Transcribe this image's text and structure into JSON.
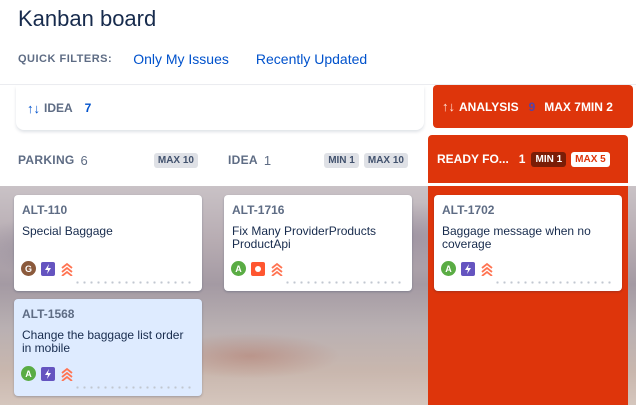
{
  "board": {
    "title": "Kanban board"
  },
  "filters": {
    "label": "QUICK FILTERS:",
    "items": [
      "Only My Issues",
      "Recently Updated"
    ]
  },
  "swimlane": {
    "arrows": "↑↓",
    "name": "IDEA",
    "count": "7"
  },
  "analysis": {
    "arrows": "↑↓",
    "name": "ANALYSIS",
    "count": "9",
    "limits": "MAX 7MIN 2"
  },
  "columns": [
    {
      "name": "PARKING",
      "count": "6",
      "min": "",
      "max": "MAX 10"
    },
    {
      "name": "IDEA",
      "count": "1",
      "min": "MIN 1",
      "max": "MAX 10"
    },
    {
      "name": "READY FO...",
      "count": "1",
      "min": "MIN 1",
      "max": "MAX 5"
    }
  ],
  "cards": [
    {
      "key": "ALT-110",
      "summary": "Special Baggage",
      "avatar": "G",
      "avatar_color": "#8b5a3c",
      "type_icon": "epic-lightning-icon",
      "priority_icon": "priority-highest-icon"
    },
    {
      "key": "ALT-1568",
      "summary": "Change the baggage list order in mobile",
      "avatar": "A",
      "avatar_color": "#5aac44",
      "type_icon": "epic-lightning-icon",
      "priority_icon": "priority-highest-icon"
    },
    {
      "key": "ALT-1716",
      "summary": "Fix Many ProviderProducts ProductApi",
      "avatar": "A",
      "avatar_color": "#5aac44",
      "type_icon": "bug-icon",
      "priority_icon": "priority-highest-icon"
    },
    {
      "key": "ALT-1702",
      "summary": "Baggage message when no coverage",
      "avatar": "A",
      "avatar_color": "#5aac44",
      "type_icon": "epic-lightning-icon",
      "priority_icon": "priority-highest-icon"
    }
  ],
  "colors": {
    "accent": "#0052cc",
    "over_limit": "#de350b",
    "epic": "#6554c0",
    "priority": "#ff7452"
  }
}
